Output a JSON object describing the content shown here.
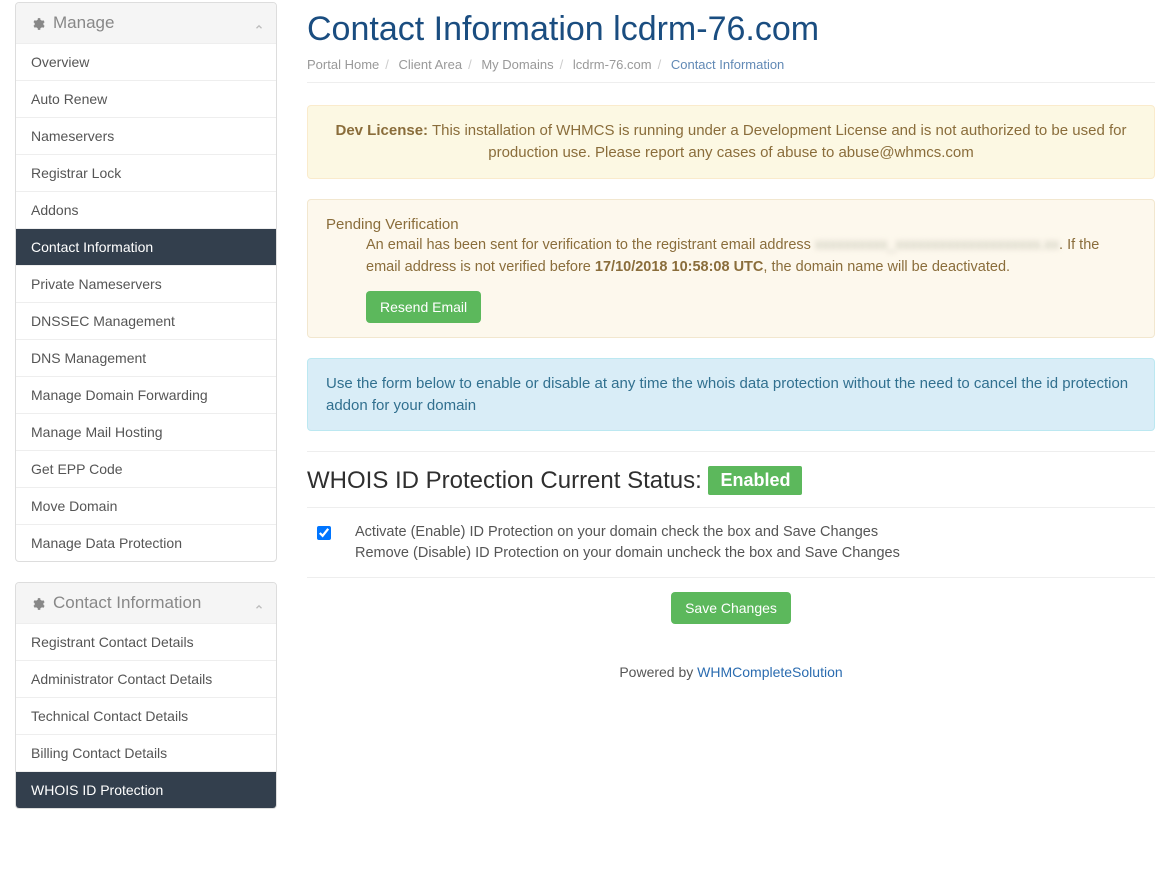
{
  "sidebar": {
    "manage": {
      "title": "Manage",
      "items": [
        {
          "label": "Overview"
        },
        {
          "label": "Auto Renew"
        },
        {
          "label": "Nameservers"
        },
        {
          "label": "Registrar Lock"
        },
        {
          "label": "Addons"
        },
        {
          "label": "Contact Information",
          "active": true
        },
        {
          "label": "Private Nameservers"
        },
        {
          "label": "DNSSEC Management"
        },
        {
          "label": "DNS Management"
        },
        {
          "label": "Manage Domain Forwarding"
        },
        {
          "label": "Manage Mail Hosting"
        },
        {
          "label": "Get EPP Code"
        },
        {
          "label": "Move Domain"
        },
        {
          "label": "Manage Data Protection"
        }
      ]
    },
    "contact": {
      "title": "Contact Information",
      "items": [
        {
          "label": "Registrant Contact Details"
        },
        {
          "label": "Administrator Contact Details"
        },
        {
          "label": "Technical Contact Details"
        },
        {
          "label": "Billing Contact Details"
        },
        {
          "label": "WHOIS ID Protection",
          "active": true
        }
      ]
    }
  },
  "page": {
    "title": "Contact Information lcdrm-76.com"
  },
  "breadcrumb": {
    "items": [
      "Portal Home",
      "Client Area",
      "My Domains",
      "lcdrm-76.com"
    ],
    "current": "Contact Information"
  },
  "alerts": {
    "dev_license": {
      "prefix": "Dev License:",
      "text": " This installation of WHMCS is running under a Development License and is not authorized to be used for production use. Please report any cases of abuse to abuse@whmcs.com"
    },
    "pending": {
      "title": "Pending Verification",
      "text1": "An email has been sent for verification to the registrant email address ",
      "redacted": "xxxxxxxxxx_xxxxxxxxxxxxxxxxxxxx.xx",
      "text2": ". If the email address is not verified before ",
      "deadline": "17/10/2018 10:58:08 UTC",
      "text3": ", the domain name will be deactivated.",
      "button": "Resend Email"
    },
    "info": "Use the form below to enable or disable at any time the whois data protection without the need to cancel the id protection addon for your domain"
  },
  "whois": {
    "title_prefix": "WHOIS ID Protection Current Status: ",
    "status_badge": "Enabled",
    "line1": "Activate (Enable) ID Protection on your domain check the box and Save Changes",
    "line2": "Remove (Disable) ID Protection on your domain uncheck the box and Save Changes",
    "save": "Save Changes"
  },
  "footer": {
    "prefix": "Powered by ",
    "link": "WHMCompleteSolution"
  }
}
